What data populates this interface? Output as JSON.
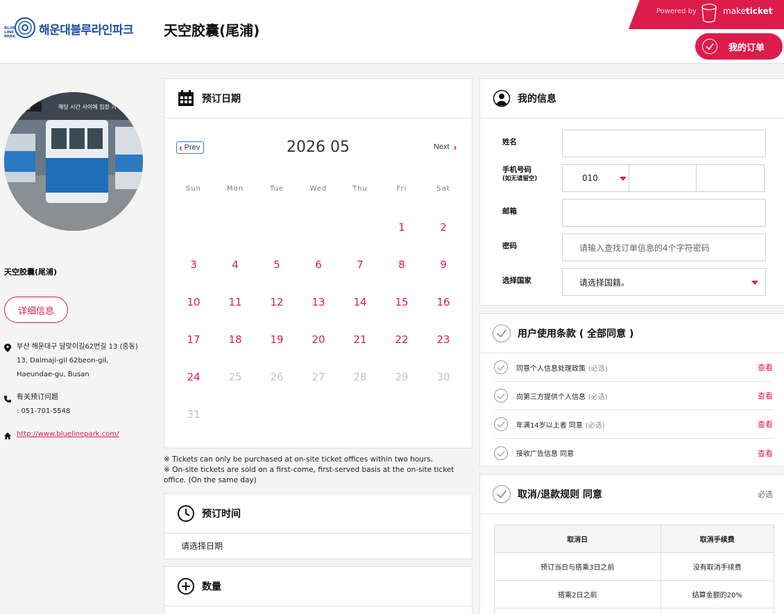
{
  "header": {
    "logo_ko": "해운대블루라인파크",
    "logo_mark_text": "BLUE LINE PARK",
    "title": "天空胶囊(尾浦)",
    "powered_by": "Powered by",
    "brand_light": "make",
    "brand_bold": "ticket",
    "my_order": "我的订单"
  },
  "left": {
    "photo_caption": "해당 시간 사이에 입장 가",
    "photo_tag": "입슬",
    "venue_name": "天空胶囊(尾浦)",
    "detail_button": "详细信息",
    "address": "부산 해운대구 달맞이길62번길 13 (중동) 13, Dalmaji-gil 62beon-gil, Haeundae-gu, Busan",
    "phone_label": "有关预订问题",
    "phone": ": 051-701-5548",
    "website": "http://www.bluelinepark.com/"
  },
  "calendar": {
    "title": "预订日期",
    "prev": "Prev",
    "next": "Next",
    "month": "2026 05",
    "weekdays": [
      "Sun",
      "Mon",
      "Tue",
      "Wed",
      "Thu",
      "Fri",
      "Sat"
    ],
    "days": [
      {
        "d": "1",
        "active": true
      },
      {
        "d": "2",
        "active": true
      },
      {
        "d": "3",
        "active": true
      },
      {
        "d": "4",
        "active": true
      },
      {
        "d": "5",
        "active": true
      },
      {
        "d": "6",
        "active": true
      },
      {
        "d": "7",
        "active": true
      },
      {
        "d": "8",
        "active": true
      },
      {
        "d": "9",
        "active": true
      },
      {
        "d": "10",
        "active": true
      },
      {
        "d": "11",
        "active": true
      },
      {
        "d": "12",
        "active": true
      },
      {
        "d": "13",
        "active": true
      },
      {
        "d": "14",
        "active": true
      },
      {
        "d": "15",
        "active": true
      },
      {
        "d": "16",
        "active": true
      },
      {
        "d": "17",
        "active": true
      },
      {
        "d": "18",
        "active": true
      },
      {
        "d": "19",
        "active": true
      },
      {
        "d": "20",
        "active": true
      },
      {
        "d": "21",
        "active": true
      },
      {
        "d": "22",
        "active": true
      },
      {
        "d": "23",
        "active": true
      },
      {
        "d": "24",
        "active": true
      },
      {
        "d": "25",
        "active": false
      },
      {
        "d": "26",
        "active": false
      },
      {
        "d": "27",
        "active": false
      },
      {
        "d": "28",
        "active": false
      },
      {
        "d": "29",
        "active": false
      },
      {
        "d": "30",
        "active": false
      },
      {
        "d": "31",
        "active": false
      }
    ],
    "first_weekday": 5
  },
  "notes": {
    "line1": "※ Tickets can only be purchased at on-site ticket offices within two hours.",
    "line2": "※ On-site tickets are sold on a first-come, first-served basis at the on-site ticket office. (On the same day)"
  },
  "time": {
    "title": "预订时间",
    "placeholder": "请选择日期"
  },
  "quantity": {
    "title": "数量"
  },
  "my_info": {
    "title": "我的信息",
    "name_label": "姓名",
    "phone_label": "手机号码",
    "phone_sub": "(如无请留空)",
    "phone_prefix": "010",
    "email_label": "邮箱",
    "password_label": "密码",
    "password_placeholder": "请输入查找订单信息的4个字符密码",
    "country_label": "选择国家",
    "country_placeholder": "请选择国籍。"
  },
  "terms": {
    "title": "用户使用条款 ( 全部同意 )",
    "items": [
      {
        "label": "同意个人信息处理政策",
        "req": "(必选)",
        "view": "查看"
      },
      {
        "label": "向第三方提供个人信息",
        "req": "(必选)",
        "view": "查看"
      },
      {
        "label": "年满14岁以上者 同意",
        "req": "(必选)",
        "view": "查看"
      },
      {
        "label": "接收广告信息 同意",
        "req": "",
        "view": "查看"
      }
    ]
  },
  "cancel": {
    "title": "取消/退款规则 同意",
    "required": "必选",
    "headers": [
      "取消日",
      "取消手续费"
    ],
    "rows": [
      [
        "预订当日与搭乘3日之前",
        "没有取消手续费"
      ],
      [
        "搭乘2日之前",
        "结算金额的20%"
      ]
    ]
  },
  "colors": {
    "accent": "#dc1c4b",
    "logo_blue": "#1f4e9c"
  }
}
